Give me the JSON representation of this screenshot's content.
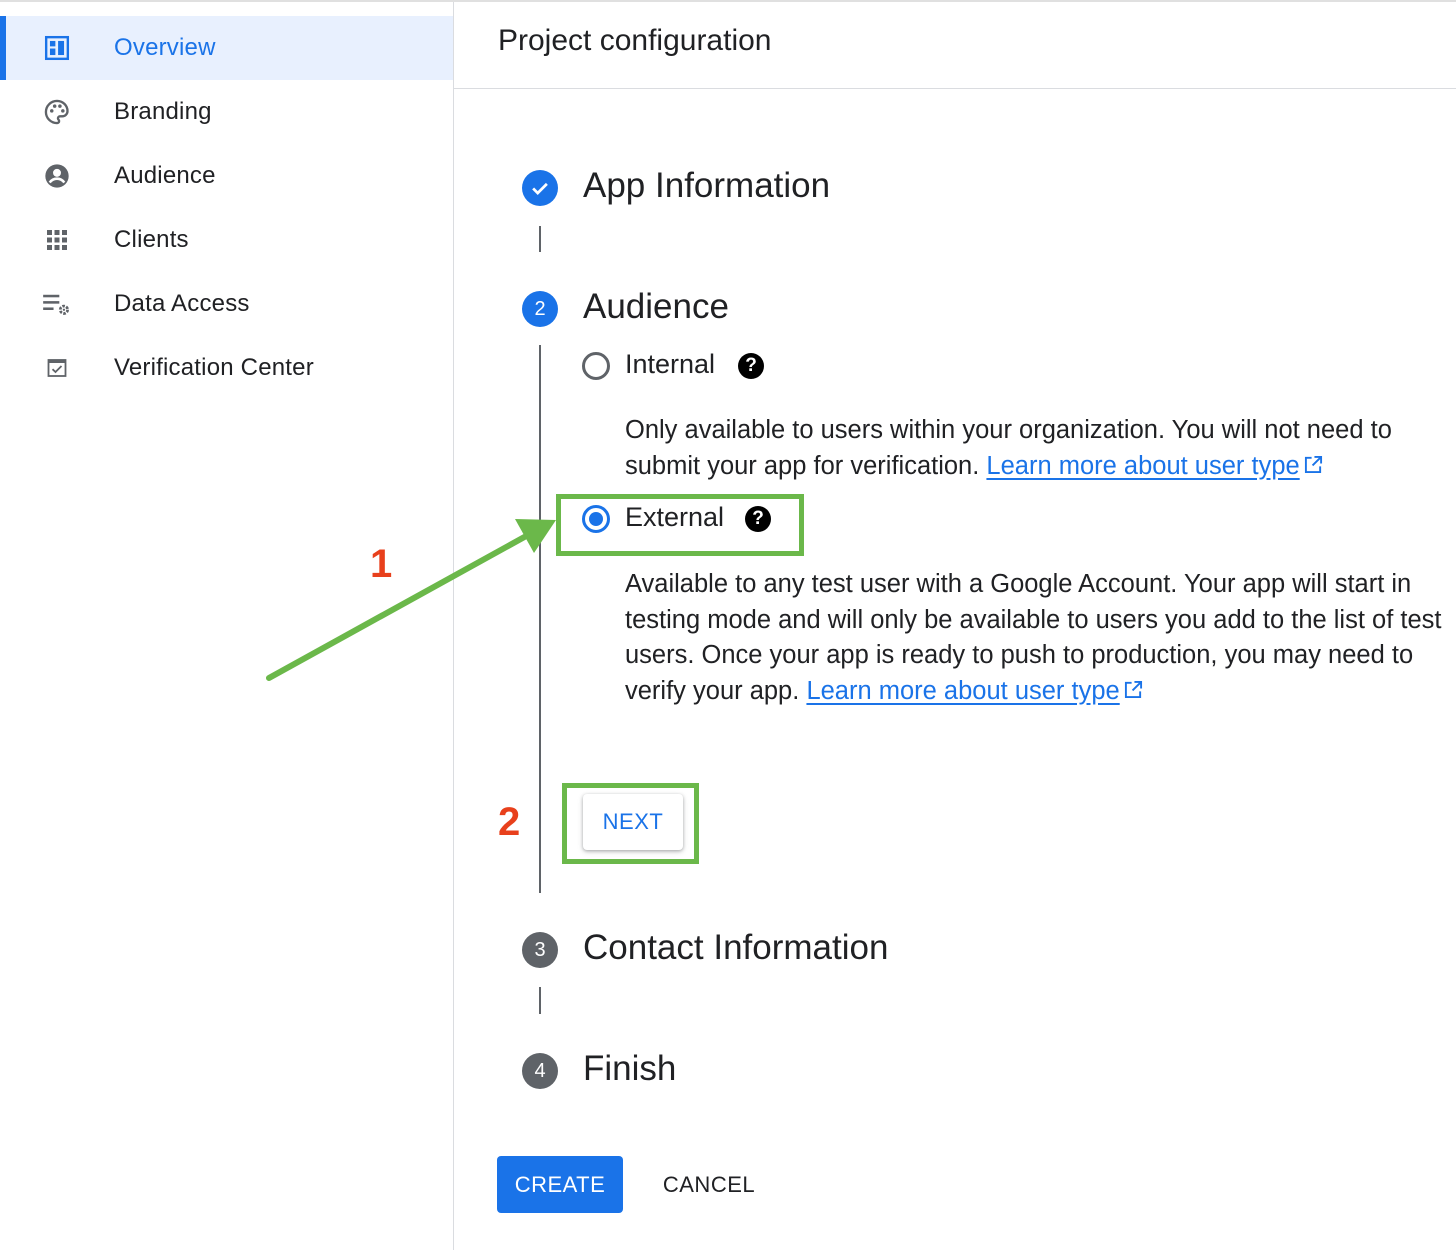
{
  "sidebar": {
    "items": [
      {
        "label": "Overview",
        "icon": "dashboard-icon",
        "active": true
      },
      {
        "label": "Branding",
        "icon": "palette-icon",
        "active": false
      },
      {
        "label": "Audience",
        "icon": "account-circle-icon",
        "active": false
      },
      {
        "label": "Clients",
        "icon": "apps-grid-icon",
        "active": false
      },
      {
        "label": "Data Access",
        "icon": "list-settings-icon",
        "active": false
      },
      {
        "label": "Verification Center",
        "icon": "checkbox-icon",
        "active": false
      }
    ]
  },
  "main": {
    "title": "Project configuration",
    "steps": [
      {
        "number": "",
        "title": "App Information",
        "state": "completed"
      },
      {
        "number": "2",
        "title": "Audience",
        "state": "active"
      },
      {
        "number": "3",
        "title": "Contact Information",
        "state": "pending"
      },
      {
        "number": "4",
        "title": "Finish",
        "state": "pending"
      }
    ],
    "audience": {
      "internal": {
        "label": "Internal",
        "checked": false,
        "description": "Only available to users within your organization. You will not need to submit your app for verification.",
        "link": "Learn more about user type"
      },
      "external": {
        "label": "External",
        "checked": true,
        "description": "Available to any test user with a Google Account. Your app will start in testing mode and will only be available to users you add to the list of test users. Once your app is ready to push to production, you may need to verify your app.",
        "link": "Learn more about user type"
      },
      "next_label": "NEXT"
    },
    "create_label": "CREATE",
    "cancel_label": "CANCEL"
  },
  "annotations": {
    "step1": "1",
    "step2": "2",
    "highlight_color": "#6bb84a",
    "number_color": "#e8401c"
  },
  "colors": {
    "accent": "#1a73e8",
    "active_bg": "#e8f0fe",
    "pending_step": "#5f6368"
  }
}
